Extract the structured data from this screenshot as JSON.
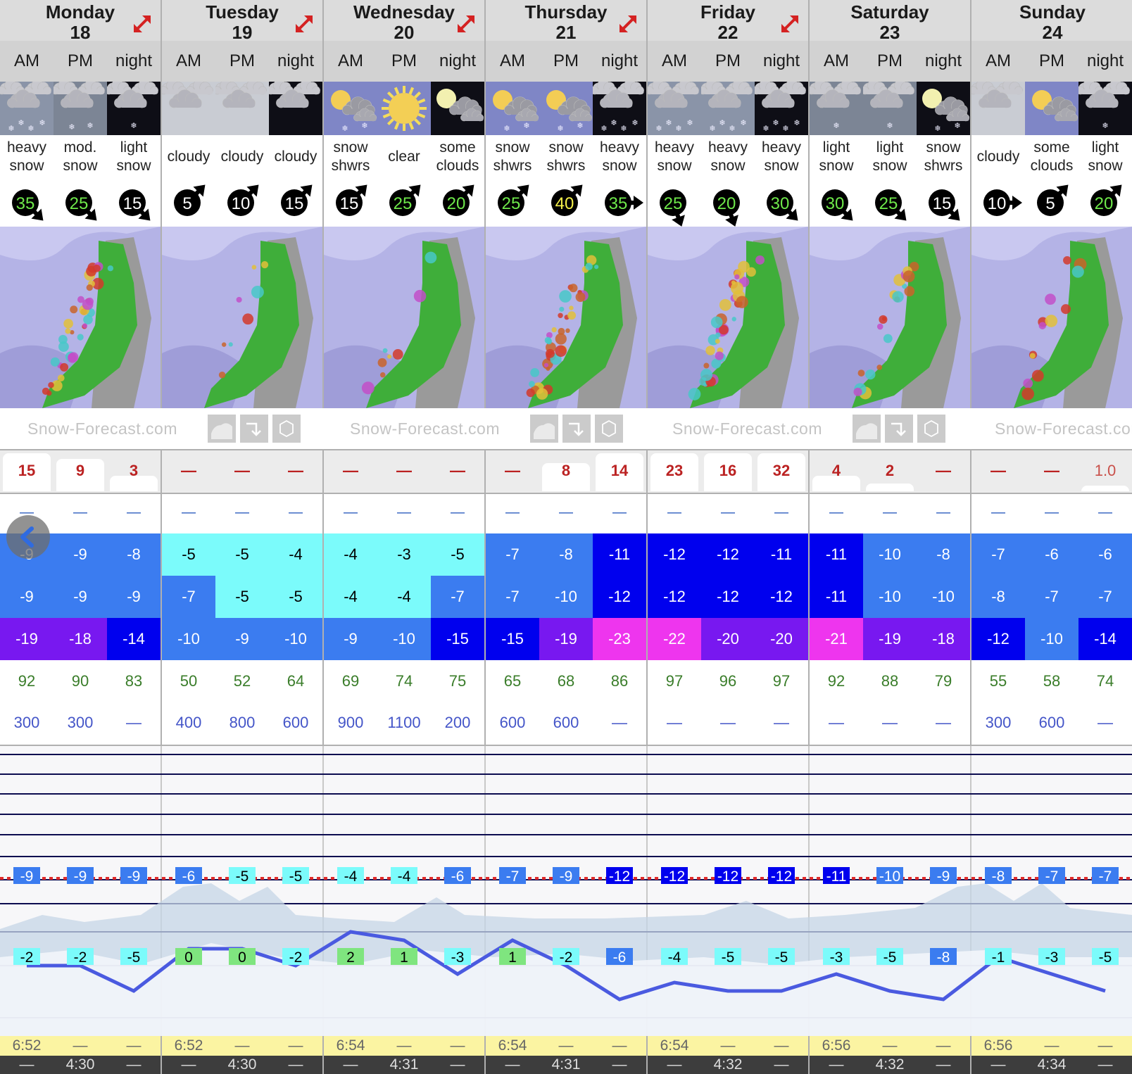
{
  "brand": "Snow-Forecast.com",
  "periods": [
    "AM",
    "PM",
    "night"
  ],
  "days": [
    {
      "name": "Monday",
      "date": "18",
      "expandable": true,
      "icons": [
        "heavy-snow",
        "mod-snow",
        "light-snow-night"
      ],
      "summary": [
        [
          "heavy",
          "snow"
        ],
        [
          "mod.",
          "snow"
        ],
        [
          "light",
          "snow"
        ]
      ],
      "wind": [
        {
          "speed": "35",
          "dir": "se",
          "color": "#6ee84a"
        },
        {
          "speed": "25",
          "dir": "se",
          "color": "#6ee84a"
        },
        {
          "speed": "15",
          "dir": "se",
          "color": "#ffffff"
        }
      ],
      "snow": [
        "15",
        "9",
        "3"
      ],
      "snow_level": [
        1.0,
        0.85,
        0.4
      ],
      "rain": [
        "—",
        "—",
        "—"
      ],
      "max": [
        "-9",
        "-9",
        "-8"
      ],
      "min": [
        "-9",
        "-9",
        "-9"
      ],
      "chill": [
        "-19",
        "-18",
        "-14"
      ],
      "humidity": [
        "92",
        "90",
        "83"
      ],
      "freezing": [
        "300",
        "300",
        "—"
      ],
      "chart_top": [
        "-9",
        "-9",
        "-9"
      ],
      "chart_low": [
        "-2",
        "-2",
        "-5"
      ],
      "sunrise": [
        "6:52",
        "—",
        "—"
      ],
      "sunset": [
        "—",
        "4:30",
        "—"
      ]
    },
    {
      "name": "Tuesday",
      "date": "19",
      "expandable": true,
      "icons": [
        "cloudy",
        "cloudy",
        "cloudy-night"
      ],
      "summary": [
        [
          "cloudy"
        ],
        [
          "cloudy"
        ],
        [
          "cloudy"
        ]
      ],
      "wind": [
        {
          "speed": "5",
          "dir": "ne",
          "color": "#ffffff"
        },
        {
          "speed": "10",
          "dir": "ne",
          "color": "#ffffff"
        },
        {
          "speed": "15",
          "dir": "ne",
          "color": "#ffffff"
        }
      ],
      "snow": [
        "—",
        "—",
        "—"
      ],
      "snow_level": [
        0,
        0,
        0
      ],
      "rain": [
        "—",
        "—",
        "—"
      ],
      "max": [
        "-5",
        "-5",
        "-4"
      ],
      "min": [
        "-7",
        "-5",
        "-5"
      ],
      "chill": [
        "-10",
        "-9",
        "-10"
      ],
      "humidity": [
        "50",
        "52",
        "64"
      ],
      "freezing": [
        "400",
        "800",
        "600"
      ],
      "chart_top": [
        "-6",
        "-5",
        "-5"
      ],
      "chart_low": [
        "0",
        "0",
        "-2"
      ],
      "sunrise": [
        "6:52",
        "—",
        "—"
      ],
      "sunset": [
        "—",
        "4:30",
        "—"
      ]
    },
    {
      "name": "Wednesday",
      "date": "20",
      "expandable": true,
      "icons": [
        "snow-showers",
        "clear",
        "some-clouds-night"
      ],
      "summary": [
        [
          "snow",
          "shwrs"
        ],
        [
          "clear"
        ],
        [
          "some",
          "clouds"
        ]
      ],
      "wind": [
        {
          "speed": "15",
          "dir": "ne",
          "color": "#ffffff"
        },
        {
          "speed": "25",
          "dir": "ne",
          "color": "#6ee84a"
        },
        {
          "speed": "20",
          "dir": "ne",
          "color": "#6ee84a"
        }
      ],
      "snow": [
        "—",
        "—",
        "—"
      ],
      "snow_level": [
        0,
        0,
        0
      ],
      "rain": [
        "—",
        "—",
        "—"
      ],
      "max": [
        "-4",
        "-3",
        "-5"
      ],
      "min": [
        "-4",
        "-4",
        "-7"
      ],
      "chill": [
        "-9",
        "-10",
        "-15"
      ],
      "humidity": [
        "69",
        "74",
        "75"
      ],
      "freezing": [
        "900",
        "1100",
        "200"
      ],
      "chart_top": [
        "-4",
        "-4",
        "-6"
      ],
      "chart_low": [
        "2",
        "1",
        "-3"
      ],
      "sunrise": [
        "6:54",
        "—",
        "—"
      ],
      "sunset": [
        "—",
        "4:31",
        "—"
      ]
    },
    {
      "name": "Thursday",
      "date": "21",
      "expandable": true,
      "icons": [
        "snow-showers",
        "snow-showers",
        "heavy-snow-night"
      ],
      "summary": [
        [
          "snow",
          "shwrs"
        ],
        [
          "snow",
          "shwrs"
        ],
        [
          "heavy",
          "snow"
        ]
      ],
      "wind": [
        {
          "speed": "25",
          "dir": "ne",
          "color": "#6ee84a"
        },
        {
          "speed": "40",
          "dir": "ne",
          "color": "#f4f04a"
        },
        {
          "speed": "35",
          "dir": "e",
          "color": "#6ee84a"
        }
      ],
      "snow": [
        "—",
        "8",
        "14"
      ],
      "snow_level": [
        0,
        0.75,
        1.0
      ],
      "rain": [
        "—",
        "—",
        "—"
      ],
      "max": [
        "-7",
        "-8",
        "-11"
      ],
      "min": [
        "-7",
        "-10",
        "-12"
      ],
      "chill": [
        "-15",
        "-19",
        "-23"
      ],
      "humidity": [
        "65",
        "68",
        "86"
      ],
      "freezing": [
        "600",
        "600",
        "—"
      ],
      "chart_top": [
        "-7",
        "-9",
        "-12"
      ],
      "chart_low": [
        "1",
        "-2",
        "-6"
      ],
      "sunrise": [
        "6:54",
        "—",
        "—"
      ],
      "sunset": [
        "—",
        "4:31",
        "—"
      ]
    },
    {
      "name": "Friday",
      "date": "22",
      "expandable": true,
      "icons": [
        "heavy-snow",
        "heavy-snow",
        "heavy-snow-night"
      ],
      "summary": [
        [
          "heavy",
          "snow"
        ],
        [
          "heavy",
          "snow"
        ],
        [
          "heavy",
          "snow"
        ]
      ],
      "wind": [
        {
          "speed": "25",
          "dir": "s",
          "color": "#6ee84a"
        },
        {
          "speed": "20",
          "dir": "s",
          "color": "#6ee84a"
        },
        {
          "speed": "30",
          "dir": "se",
          "color": "#6ee84a"
        }
      ],
      "snow": [
        "23",
        "16",
        "32"
      ],
      "snow_level": [
        1.0,
        1.0,
        1.0
      ],
      "rain": [
        "—",
        "—",
        "—"
      ],
      "max": [
        "-12",
        "-12",
        "-11"
      ],
      "min": [
        "-12",
        "-12",
        "-12"
      ],
      "chill": [
        "-22",
        "-20",
        "-20"
      ],
      "humidity": [
        "97",
        "96",
        "97"
      ],
      "freezing": [
        "—",
        "—",
        "—"
      ],
      "chart_top": [
        "-12",
        "-12",
        "-12"
      ],
      "chart_low": [
        "-4",
        "-5",
        "-5"
      ],
      "sunrise": [
        "6:54",
        "—",
        "—"
      ],
      "sunset": [
        "—",
        "4:32",
        "—"
      ]
    },
    {
      "name": "Saturday",
      "date": "23",
      "expandable": false,
      "icons": [
        "light-snow",
        "light-snow",
        "snow-showers-night"
      ],
      "summary": [
        [
          "light",
          "snow"
        ],
        [
          "light",
          "snow"
        ],
        [
          "snow",
          "shwrs"
        ]
      ],
      "wind": [
        {
          "speed": "30",
          "dir": "se",
          "color": "#6ee84a"
        },
        {
          "speed": "25",
          "dir": "se",
          "color": "#6ee84a"
        },
        {
          "speed": "15",
          "dir": "se",
          "color": "#ffffff"
        }
      ],
      "snow": [
        "4",
        "2",
        "—"
      ],
      "snow_level": [
        0.4,
        0.2,
        0
      ],
      "rain": [
        "—",
        "—",
        "—"
      ],
      "max": [
        "-11",
        "-10",
        "-8"
      ],
      "min": [
        "-11",
        "-10",
        "-10"
      ],
      "chill": [
        "-21",
        "-19",
        "-18"
      ],
      "humidity": [
        "92",
        "88",
        "79"
      ],
      "freezing": [
        "—",
        "—",
        "—"
      ],
      "chart_top": [
        "-11",
        "-10",
        "-9"
      ],
      "chart_low": [
        "-3",
        "-5",
        "-8"
      ],
      "sunrise": [
        "6:56",
        "—",
        "—"
      ],
      "sunset": [
        "—",
        "4:32",
        "—"
      ]
    },
    {
      "name": "Sunday",
      "date": "24",
      "expandable": false,
      "icons": [
        "cloudy",
        "some-clouds",
        "light-snow-night"
      ],
      "summary": [
        [
          "cloudy"
        ],
        [
          "some",
          "clouds"
        ],
        [
          "light",
          "snow"
        ]
      ],
      "wind": [
        {
          "speed": "10",
          "dir": "e",
          "color": "#ffffff"
        },
        {
          "speed": "5",
          "dir": "ne",
          "color": "#ffffff"
        },
        {
          "speed": "20",
          "dir": "ne",
          "color": "#6ee84a"
        }
      ],
      "snow": [
        "—",
        "—",
        "1.0"
      ],
      "snow_level": [
        0,
        0,
        0.15
      ],
      "rain": [
        "—",
        "—",
        "—"
      ],
      "max": [
        "-7",
        "-6",
        "-6"
      ],
      "min": [
        "-8",
        "-7",
        "-7"
      ],
      "chill": [
        "-12",
        "-10",
        "-14"
      ],
      "humidity": [
        "55",
        "58",
        "74"
      ],
      "freezing": [
        "300",
        "600",
        "—"
      ],
      "chart_top": [
        "-8",
        "-7",
        "-7"
      ],
      "chart_low": [
        "-1",
        "-3",
        "-5"
      ],
      "sunrise": [
        "6:56",
        "—",
        "—"
      ],
      "sunset": [
        "—",
        "4:34",
        "—"
      ]
    }
  ],
  "temp_colors": {
    "warm": "#7bfbfb",
    "cool": "#3b7cf0",
    "cold": "#0000ee",
    "vcold": "#7818f0",
    "extreme": "#ee35ee",
    "positive": "#7fe57f"
  },
  "temperature_line": [
    -2,
    -2,
    -5,
    0,
    0,
    -2,
    2,
    1,
    -3,
    1,
    -2,
    -6,
    -4,
    -5,
    -5,
    -3,
    -5,
    -8,
    -1,
    -3,
    -5
  ]
}
